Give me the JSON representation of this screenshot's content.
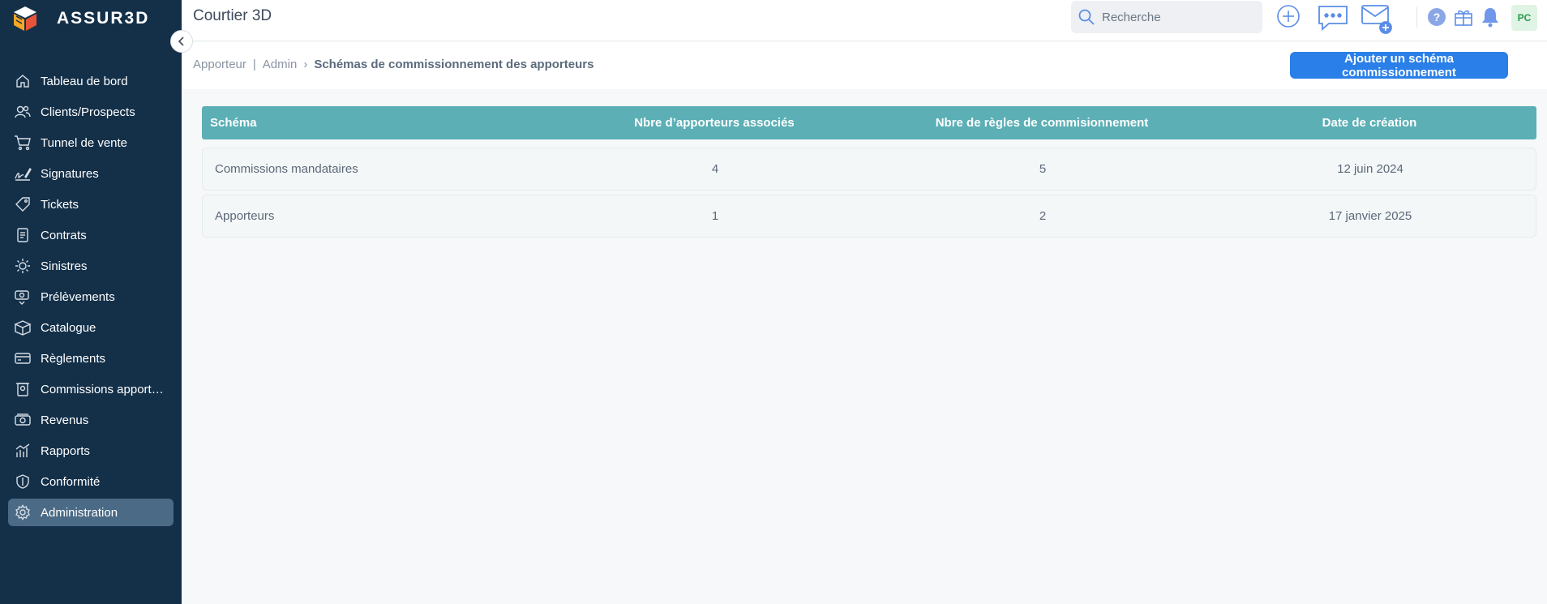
{
  "app": {
    "logo_text": "ASSUR3D",
    "title": "Courtier 3D"
  },
  "sidebar": {
    "items": [
      {
        "label": "Tableau de bord",
        "icon": "home-icon"
      },
      {
        "label": "Clients/Prospects",
        "icon": "users-icon"
      },
      {
        "label": "Tunnel de vente",
        "icon": "cart-icon"
      },
      {
        "label": "Signatures",
        "icon": "signature-icon"
      },
      {
        "label": "Tickets",
        "icon": "ticket-icon"
      },
      {
        "label": "Contrats",
        "icon": "contract-icon"
      },
      {
        "label": "Sinistres",
        "icon": "claim-icon"
      },
      {
        "label": "Prélèvements",
        "icon": "debit-icon"
      },
      {
        "label": "Catalogue",
        "icon": "catalog-icon"
      },
      {
        "label": "Règlements",
        "icon": "payment-card-icon"
      },
      {
        "label": "Commissions apporteurs",
        "icon": "commission-icon"
      },
      {
        "label": "Revenus",
        "icon": "revenue-icon"
      },
      {
        "label": "Rapports",
        "icon": "report-chart-icon"
      },
      {
        "label": "Conformité",
        "icon": "shield-icon"
      },
      {
        "label": "Administration",
        "icon": "gear-icon",
        "active": true
      }
    ]
  },
  "header": {
    "search_placeholder": "Recherche",
    "avatar_initials": "PC"
  },
  "breadcrumb": {
    "item1": "Apporteur",
    "item2": "Admin",
    "current": "Schémas de commissionnement des apporteurs"
  },
  "actions": {
    "add_label": "Ajouter un schéma commissionnement"
  },
  "table": {
    "columns": [
      "Schéma",
      "Nbre d’apporteurs associés",
      "Nbre de règles de commisionnement",
      "Date de création"
    ],
    "rows": [
      [
        "Commissions mandataires",
        "4",
        "5",
        "12 juin 2024"
      ],
      [
        "Apporteurs",
        "1",
        "2",
        "17 janvier 2025"
      ]
    ]
  },
  "colors": {
    "sidebar_bg": "#143049",
    "active_item_bg": "#4a6a86",
    "table_header_bg": "#5bafb5",
    "primary_button": "#2a7fe8",
    "accent_icon": "#5b8de8"
  }
}
